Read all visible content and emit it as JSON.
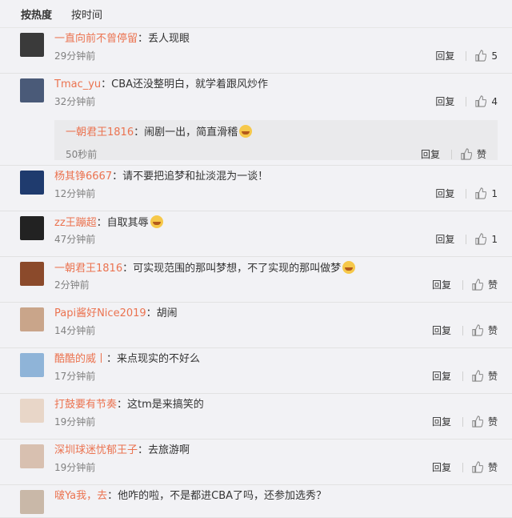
{
  "tabs": [
    {
      "label": "按热度",
      "active": true
    },
    {
      "label": "按时间",
      "active": false
    }
  ],
  "comments": [
    {
      "user": "一直向前不曾停留",
      "text": "：丢人现眼",
      "time": "29分钟前",
      "reply": "回复",
      "likes": "5",
      "avatar_color": "#3a3a3a"
    },
    {
      "user": "Tmac_yu",
      "text": "：CBA还没整明白，就学着跟风炒作",
      "time": "32分钟前",
      "reply": "回复",
      "likes": "4",
      "avatar_color": "#4a5a78",
      "sub": {
        "user": "一朝君王1816",
        "text": "：闹剧一出，简直滑稽",
        "time": "50秒前",
        "reply": "回复",
        "likes": "赞"
      }
    },
    {
      "user": "杨其铮6667",
      "text": "：请不要把追梦和扯淡混为一谈！",
      "time": "12分钟前",
      "reply": "回复",
      "likes": "1",
      "avatar_color": "#1f3b6e"
    },
    {
      "user": "zz王蹦超",
      "text": "：自取其辱",
      "time": "47分钟前",
      "reply": "回复",
      "likes": "1",
      "avatar_color": "#222222"
    },
    {
      "user": "一朝君王1816",
      "text": "：可实现范围的那叫梦想，不了实现的那叫做梦",
      "time": "2分钟前",
      "reply": "回复",
      "likes": "赞",
      "avatar_color": "#8b4a2b"
    },
    {
      "user": "Papi酱好Nice2019",
      "text": "：胡闹",
      "time": "14分钟前",
      "reply": "回复",
      "likes": "赞",
      "avatar_color": "#c9a58a"
    },
    {
      "user": "酷酷的威丨",
      "text": "：来点现实的不好么",
      "time": "17分钟前",
      "reply": "回复",
      "likes": "赞",
      "avatar_color": "#8fb4d8"
    },
    {
      "user": "打鼓要有节奏",
      "text": "：这tm是来搞笑的",
      "time": "19分钟前",
      "reply": "回复",
      "likes": "赞",
      "avatar_color": "#e8d6c8"
    },
    {
      "user": "深圳球迷忧郁王子",
      "text": "：去旅游啊",
      "time": "19分钟前",
      "reply": "回复",
      "likes": "赞",
      "avatar_color": "#d8c0b0"
    },
    {
      "user": "啵Ya我，去",
      "text": "：他咋的啦，不是都进CBA了吗，还参加选秀？",
      "time": "",
      "reply": "",
      "likes": "",
      "avatar_color": "#c9b8a8"
    }
  ],
  "emoji_after": [
    false,
    false,
    false,
    true,
    true,
    false,
    false,
    false,
    false,
    false
  ],
  "sub_emoji": true
}
